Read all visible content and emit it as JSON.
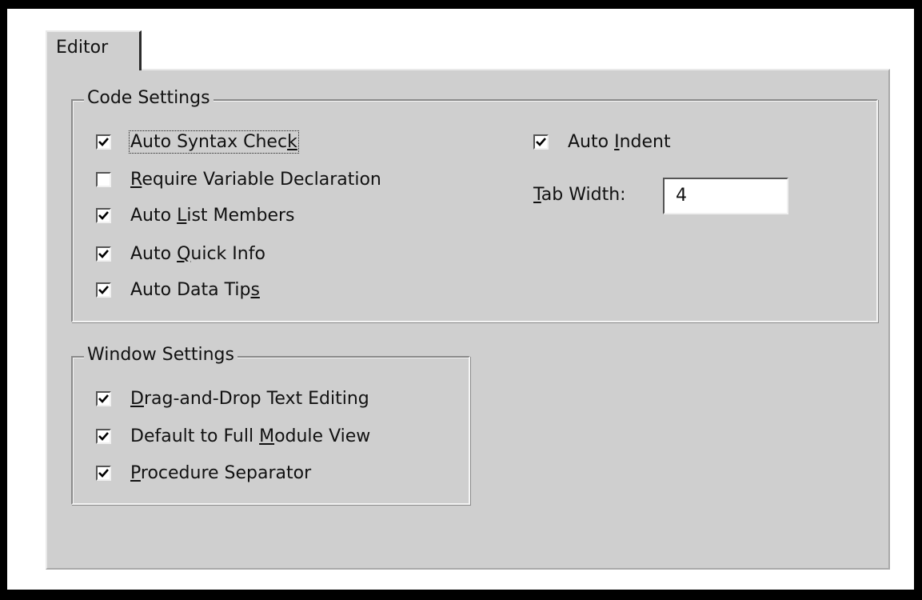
{
  "tabs": [
    {
      "label": "Editor",
      "active": true
    }
  ],
  "code_settings": {
    "title": "Code Settings",
    "options": [
      {
        "pre": "Auto Syntax Chec",
        "key": "k",
        "post": "",
        "checked": true,
        "focused": true
      },
      {
        "pre": "",
        "key": "R",
        "post": "equire Variable Declaration",
        "checked": false,
        "focused": false
      },
      {
        "pre": "Auto ",
        "key": "L",
        "post": "ist Members",
        "checked": true,
        "focused": false
      },
      {
        "pre": "Auto ",
        "key": "Q",
        "post": "uick Info",
        "checked": true,
        "focused": false
      },
      {
        "pre": "Auto Data Tip",
        "key": "s",
        "post": "",
        "checked": true,
        "focused": false
      }
    ],
    "auto_indent": {
      "pre": "Auto ",
      "key": "I",
      "post": "ndent",
      "checked": true
    },
    "tab_width": {
      "pre": "",
      "key": "T",
      "post": "ab Width:",
      "value": "4"
    }
  },
  "window_settings": {
    "title": "Window Settings",
    "options": [
      {
        "pre": "",
        "key": "D",
        "post": "rag-and-Drop Text Editing",
        "checked": true
      },
      {
        "pre": "Default to Full ",
        "key": "M",
        "post": "odule View",
        "checked": true
      },
      {
        "pre": "",
        "key": "P",
        "post": "rocedure Separator",
        "checked": true
      }
    ]
  },
  "icons": {
    "check": "check-icon"
  },
  "colors": {
    "panel": "#cfcfcf",
    "frame": "#000000"
  }
}
